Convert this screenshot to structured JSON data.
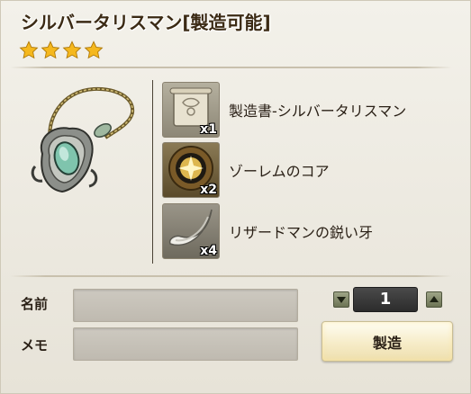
{
  "recipe": {
    "title": "シルバータリスマン[製造可能]",
    "rarity_stars": 4,
    "item_icon": "silver-talisman-icon"
  },
  "materials": [
    {
      "name": "製造書-シルバータリスマン",
      "count": "x1",
      "icon": "recipe-scroll-icon"
    },
    {
      "name": "ゾーレムのコア",
      "count": "x2",
      "icon": "golem-core-icon"
    },
    {
      "name": "リザードマンの鋭い牙",
      "count": "x4",
      "icon": "lizardman-fang-icon"
    }
  ],
  "form": {
    "name_label": "名前",
    "name_value": "",
    "memo_label": "メモ",
    "memo_value": ""
  },
  "quantity": {
    "value": "1"
  },
  "actions": {
    "craft_label": "製造"
  },
  "colors": {
    "star": "#f5b81e",
    "title": "#3b2a14",
    "button_bg": "#f6ecc8"
  }
}
